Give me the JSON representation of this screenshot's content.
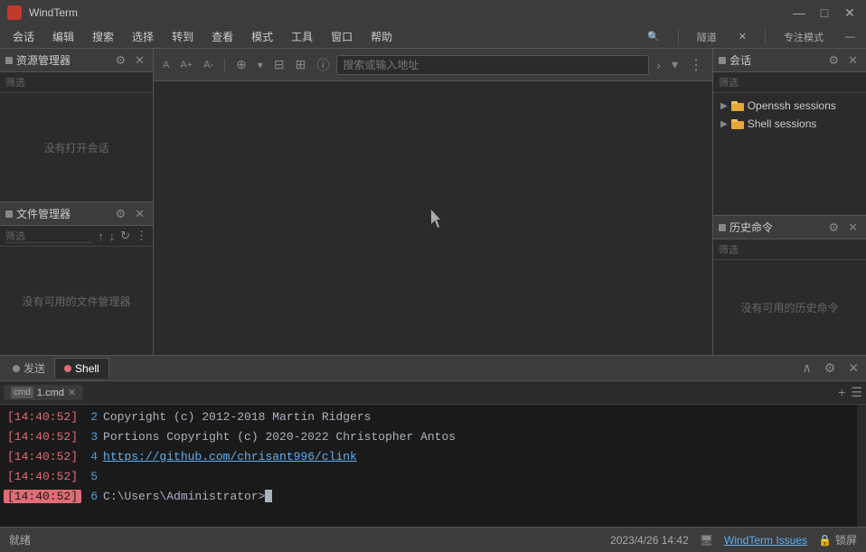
{
  "app": {
    "title": "WindTerm",
    "icon_color": "#c0392b"
  },
  "titlebar": {
    "title": "WindTerm",
    "minimize": "—",
    "maximize": "□",
    "close": "✕"
  },
  "menubar": {
    "items": [
      "会话",
      "编辑",
      "搜索",
      "选择",
      "转到",
      "查看",
      "模式",
      "工具",
      "窗口",
      "帮助"
    ],
    "tunnel_label": "隧道",
    "focus_label": "专注模式",
    "search_icon": "🔍"
  },
  "resource_panel": {
    "title": "资源管理器",
    "filter_placeholder": "筛选",
    "empty_text": "没有打开会话",
    "gear_icon": "⚙",
    "close_icon": "✕"
  },
  "file_panel": {
    "title": "文件管理器",
    "filter_placeholder": "筛选",
    "empty_text": "没有可用的文件管理器",
    "gear_icon": "⚙",
    "close_icon": "✕",
    "up_icon": "↑",
    "down_icon": "↓",
    "refresh_icon": "↻",
    "more_icon": "⋮"
  },
  "session_panel": {
    "title": "会话",
    "filter_placeholder": "筛选",
    "gear_icon": "⚙",
    "close_icon": "✕",
    "items": [
      {
        "label": "Openssh sessions",
        "folder_color": "#e8a838"
      },
      {
        "label": "Shell sessions",
        "folder_color": "#e8a838"
      }
    ]
  },
  "history_panel": {
    "title": "历史命令",
    "filter_placeholder": "筛选",
    "empty_text": "没有可用的历史命令",
    "gear_icon": "⚙",
    "close_icon": "✕"
  },
  "browser_bar": {
    "new_tab_icon": "⊕",
    "split_icon": "⊞",
    "pin_icon": "⊟",
    "info_icon": "ⓘ",
    "placeholder": "搜索或输入地址",
    "forward_icon": "›",
    "dropdown_icon": "▾",
    "more_icon": "⋮"
  },
  "terminal": {
    "send_tab_label": "发送",
    "shell_tab_label": "Shell",
    "shell_tab_dot_color": "#e06c75",
    "inner_tab_label": "1.cmd",
    "chevron_up": "∧",
    "gear_icon": "⚙",
    "close_icon": "✕",
    "plus_icon": "+",
    "list_icon": "☰",
    "lines": [
      {
        "time": "[14:40:52]",
        "linenum": "2",
        "text": "Copyright (c) 2012-2018 Martin Ridgers",
        "type": "normal",
        "active": false
      },
      {
        "time": "[14:40:52]",
        "linenum": "3",
        "text": "Portions Copyright (c) 2020-2022 Christopher Antos",
        "type": "normal",
        "active": false
      },
      {
        "time": "[14:40:52]",
        "linenum": "4",
        "text": "https://github.com/chrisant996/clink",
        "type": "url",
        "active": false
      },
      {
        "time": "[14:40:52]",
        "linenum": "5",
        "text": "",
        "type": "normal",
        "active": false
      },
      {
        "time": "[14:40:52]",
        "linenum": "6",
        "text": "C:\\Users\\Administrator>",
        "type": "prompt",
        "active": true
      }
    ]
  },
  "statusbar": {
    "left_text": "就绪",
    "datetime": "2023/4/26  14:42",
    "issues_label": "WindTerm Issues",
    "lock_label": "锁屏",
    "windterm_icon": "🖥"
  }
}
